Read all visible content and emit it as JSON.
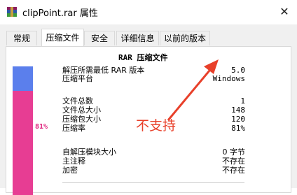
{
  "window": {
    "title": "clipPoint.rar 属性",
    "close_glyph": "✕",
    "icon": "winrar-archive-icon"
  },
  "tabs": [
    {
      "label": "常规"
    },
    {
      "label": "压缩文件"
    },
    {
      "label": "安全"
    },
    {
      "label": "详细信息"
    },
    {
      "label": "以前的版本"
    }
  ],
  "active_tab": "压缩文件",
  "panel": {
    "heading": "RAR 压缩文件",
    "ratio_text": "81%",
    "ratio": 0.81,
    "rows": [
      {
        "label": "解压所需最低 RAR 版本",
        "value": "5.0"
      },
      {
        "label": "压缩平台",
        "value": "Windows"
      },
      {
        "label": "文件总数",
        "value": "1"
      },
      {
        "label": "文件总大小",
        "value": "148"
      },
      {
        "label": "压缩包大小",
        "value": "120"
      },
      {
        "label": "压缩率",
        "value": "81%"
      },
      {
        "label": "自解压模块大小",
        "value": "0 字节"
      },
      {
        "label": "主注释",
        "value": "不存在"
      },
      {
        "label": "加密",
        "value": "不存在"
      }
    ]
  },
  "annotation": {
    "text": "不支持",
    "color": "#e8402a"
  },
  "colors": {
    "bar_top": "#5b7fec",
    "bar_bottom": "#e73d93"
  }
}
